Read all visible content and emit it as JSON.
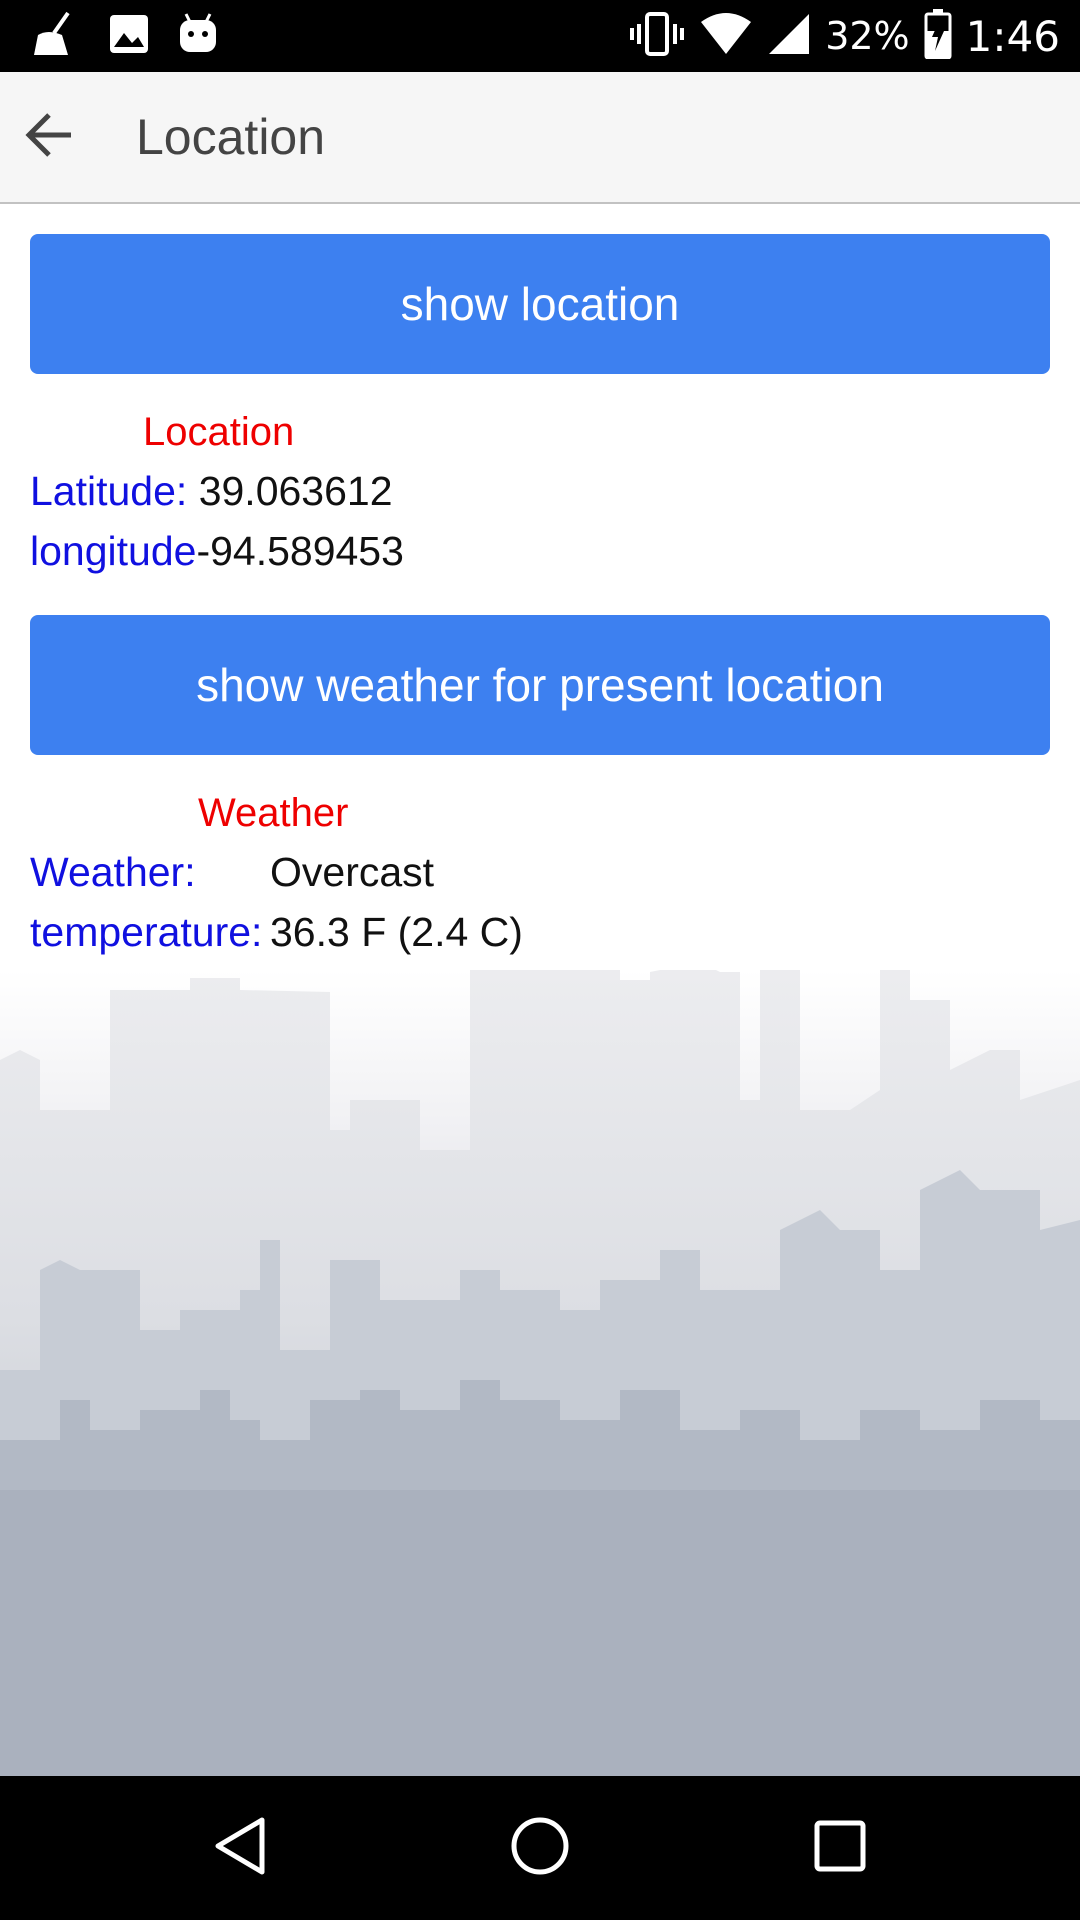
{
  "status_bar": {
    "battery": "32%",
    "time": "1:46",
    "left_icons": [
      "broom-icon",
      "image-icon",
      "android-icon"
    ],
    "right_icons": [
      "vibrate-icon",
      "wifi-icon",
      "cell-signal-icon",
      "battery-charging-icon"
    ]
  },
  "app_bar": {
    "title": "Location",
    "back_icon": "arrow-back-icon"
  },
  "location": {
    "button_label": "show location",
    "heading": "Location",
    "latitude_label": "Latitude:",
    "latitude_value": "39.063612",
    "longitude_label": "longitude",
    "longitude_value": "-94.589453"
  },
  "weather": {
    "button_label": "show weather for present location",
    "heading": "Weather",
    "weather_label": "Weather:",
    "weather_value": "Overcast",
    "temperature_label": "temperature:",
    "temperature_value": "36.3 F (2.4 C)"
  },
  "nav_bar": {
    "icons": [
      "back-triangle-icon",
      "home-circle-icon",
      "recents-square-icon"
    ]
  },
  "colors": {
    "button": "#3d80f0",
    "heading": "#ee0000",
    "label": "#1010e0",
    "app_bar": "#f6f6f6"
  }
}
